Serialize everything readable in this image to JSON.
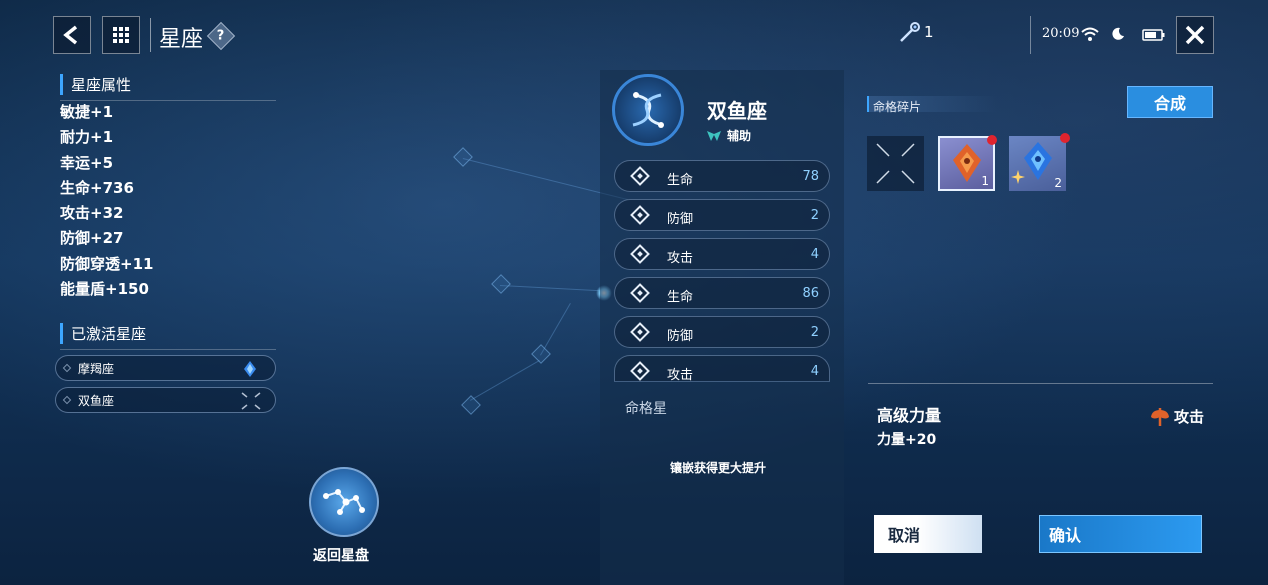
{
  "topbar": {
    "title": "星座",
    "help": "?",
    "currency_count": "1",
    "time": "20:09"
  },
  "left": {
    "attributes_heading": "星座属性",
    "attributes": [
      "敏捷+1",
      "耐力+1",
      "幸运+5",
      "生命+736",
      "攻击+32",
      "防御+27",
      "防御穿透+11",
      "能量盾+150"
    ],
    "activated_heading": "已激活星座",
    "activated": [
      "摩羯座",
      "双鱼座"
    ]
  },
  "return_button": {
    "label": "返回星盘"
  },
  "center": {
    "constellation_name": "双鱼座",
    "role_label": "辅助",
    "stats": [
      {
        "label": "生命",
        "value": "78"
      },
      {
        "label": "防御",
        "value": "2"
      },
      {
        "label": "攻击",
        "value": "4"
      },
      {
        "label": "生命",
        "value": "86"
      },
      {
        "label": "防御",
        "value": "2"
      },
      {
        "label": "攻击",
        "value": "4"
      }
    ],
    "section_label": "命格星",
    "hint": "镶嵌获得更大提升"
  },
  "right": {
    "heading": "命格碎片",
    "synth_label": "合成",
    "fragments": [
      {
        "count": "1",
        "color": "#e0622a"
      },
      {
        "count": "2",
        "color": "#2a74e0"
      }
    ],
    "detail_title": "高级力量",
    "detail_type": "攻击",
    "detail_effect": "力量+20",
    "cancel_label": "取消",
    "confirm_label": "确认"
  },
  "colors": {
    "accent": "#3da6ff",
    "confirm_bg": "#1f87d6",
    "synth_bg": "#2a8ee0",
    "attack_icon": "#e0622a"
  }
}
